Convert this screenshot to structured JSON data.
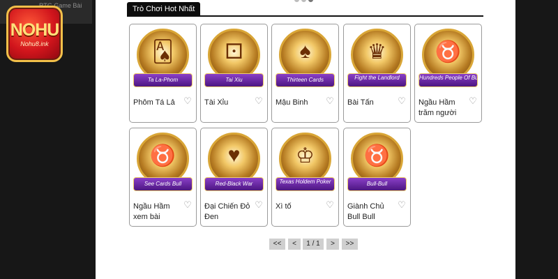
{
  "brand": {
    "logo_text": "NOHU",
    "logo_subtext": "Nohu8.ink",
    "caption_line1": "RTG Game Bài",
    "caption_line2": "..."
  },
  "section": {
    "title": "Trò Chơi Hot Nhất"
  },
  "games": [
    {
      "title": "Phôm Tá Lả",
      "banner": "Ta La-Phom",
      "icon": "playing-cards-icon"
    },
    {
      "title": "Tài Xỉu",
      "banner": "Tai Xiu",
      "icon": "dice-cup-icon"
    },
    {
      "title": "Mậu Binh",
      "banner": "Thirteen Cards",
      "icon": "revolver-icon"
    },
    {
      "title": "Bài Tấn",
      "banner": "Fight the Landlord",
      "icon": "landlord-icon"
    },
    {
      "title": "Ngầu Hầm trăm người",
      "banner": "Hundreds People Of Bull",
      "icon": "bull-icon"
    },
    {
      "title": "Ngầu Hầm xem bài",
      "banner": "See Cards Bull",
      "icon": "bull-cards-icon"
    },
    {
      "title": "Đại Chiến Đỏ Đen",
      "banner": "Red-Black War",
      "icon": "vs-cards-icon"
    },
    {
      "title": "Xì tố",
      "banner": "Texas Holdem Poker",
      "icon": "crown-icon"
    },
    {
      "title": "Giành Chủ Bull Bull",
      "banner": "Bull-Bull",
      "icon": "golden-bull-icon"
    }
  ],
  "pagination": {
    "first": "<<",
    "prev": "<",
    "current": "1 / 1",
    "next": ">",
    "last": ">>"
  }
}
